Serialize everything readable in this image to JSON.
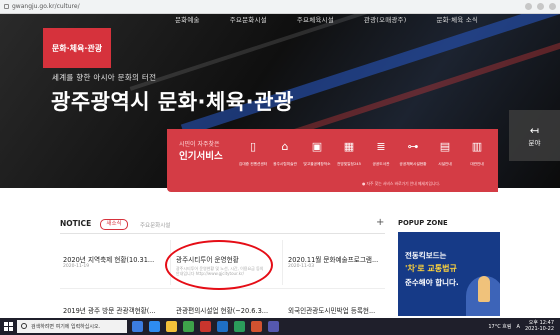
{
  "browser": {
    "url": "gwangju.go.kr/culture/"
  },
  "topnav": [
    "문화예술",
    "주요문화시설",
    "주요체육시설",
    "관광(오매광주)",
    "문화·체육 소식"
  ],
  "badge": "문화·체육·관광",
  "hero": {
    "tagline": "세계를 향한 아시아 문화의 터전",
    "headline": "광주광역시 문화·체육·관광"
  },
  "side_button": {
    "arrow": "↤",
    "label": "분야"
  },
  "services": {
    "subtitle": "시민이 자주찾은",
    "title": "인기서비스",
    "items": [
      {
        "icon": "building-icon",
        "glyph": "▯",
        "label": "김대중 컨벤션센터"
      },
      {
        "icon": "gallery-icon",
        "glyph": "⌂",
        "label": "광주시립미술관"
      },
      {
        "icon": "theater-icon",
        "glyph": "▣",
        "label": "빛고을공예창작소"
      },
      {
        "icon": "calendar-icon",
        "glyph": "▦",
        "label": "전망및일정245"
      },
      {
        "icon": "book-icon",
        "glyph": "≣",
        "label": "공공도서관"
      },
      {
        "icon": "gym-icon",
        "glyph": "⊶",
        "label": "공공체육시설현황"
      },
      {
        "icon": "facility-icon",
        "glyph": "▤",
        "label": "시설안내"
      },
      {
        "icon": "rental-icon",
        "glyph": "▥",
        "label": "대관안내"
      },
      {
        "icon": "sign-icon",
        "glyph": "⊣",
        "label": "찾아오시는길"
      }
    ],
    "note": "● 자주 찾는 서비스 바로가기 안내 메세지입니다."
  },
  "notice": {
    "heading": "NOTICE",
    "tab_active": "새소식",
    "tab_other": "주요문화시설",
    "plus": "+",
    "items": [
      {
        "title": "2020년 지역축제 현황(10.31...",
        "date": "2020-11-19"
      },
      {
        "title": "광주시티투어 운영현황",
        "desc": "광주시티투어 운영현황 및 노선, 시간, 이용요금 등의 안내입니다 http://www.gjcitytour.kr/"
      },
      {
        "title": "2020.11월 문화예술프로그램...",
        "date": "2020-11-03"
      },
      {
        "title": "2019년 광주 방문 관광객현황(...",
        "date": ""
      },
      {
        "title": "관광편의시설업 현황(~20.6.3...",
        "date": ""
      },
      {
        "title": "외국인관광도시민박업 등록현...",
        "date": ""
      }
    ]
  },
  "popup": {
    "heading": "POPUP ZONE",
    "line1": "전동킥보드는",
    "line2": "'차'로 교통법규",
    "line3": "준수해야 합니다."
  },
  "taskbar": {
    "search_placeholder": "검색하려면 여기에 입력하십시오.",
    "temperature": "17°C 흐림",
    "ime": "A",
    "time": "오후 12:47",
    "date": "2021-10-22"
  }
}
